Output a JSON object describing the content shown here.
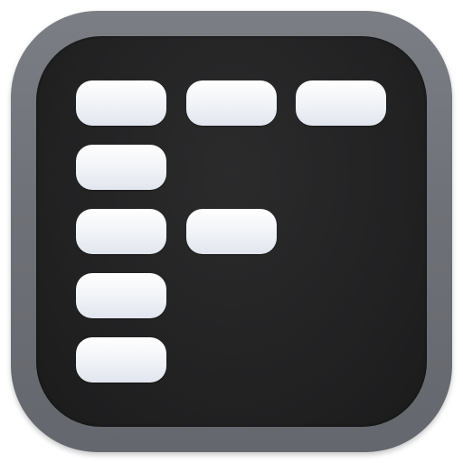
{
  "icon": {
    "name": "grid-layout-icon",
    "colors": {
      "outer_frame": "#6e7177",
      "inner_face": "#222223",
      "tile": "#eef1f6"
    },
    "tile_pattern": [
      [
        true,
        true,
        true
      ],
      [
        true,
        false,
        false
      ],
      [
        true,
        true,
        false
      ],
      [
        true,
        false,
        false
      ],
      [
        true,
        false,
        false
      ]
    ]
  }
}
